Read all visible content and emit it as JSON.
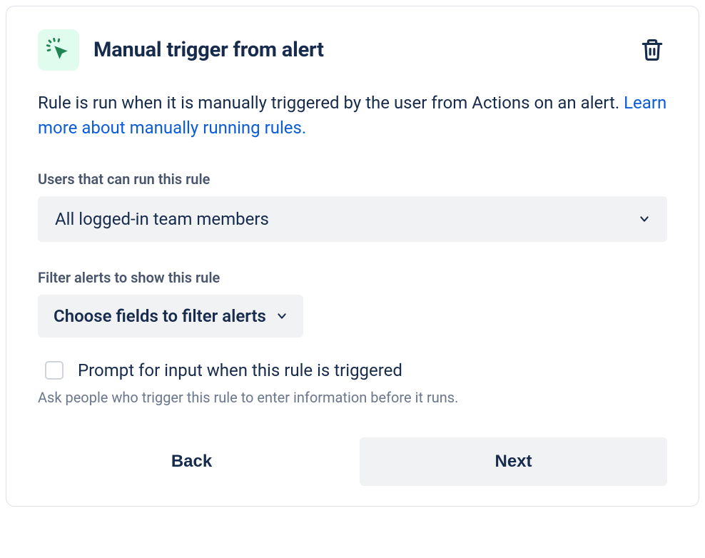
{
  "header": {
    "title": "Manual trigger from alert"
  },
  "description": {
    "text": "Rule is run when it is manually triggered by the user from Actions on an alert. ",
    "link": "Learn more about manually running rules."
  },
  "users_field": {
    "label": "Users that can run this rule",
    "value": "All logged-in team members"
  },
  "filter_field": {
    "label": "Filter alerts to show this rule",
    "value": "Choose fields to filter alerts"
  },
  "prompt_checkbox": {
    "label": "Prompt for input when this rule is triggered",
    "hint": "Ask people who trigger this rule to enter information before it runs."
  },
  "buttons": {
    "back": "Back",
    "next": "Next"
  }
}
